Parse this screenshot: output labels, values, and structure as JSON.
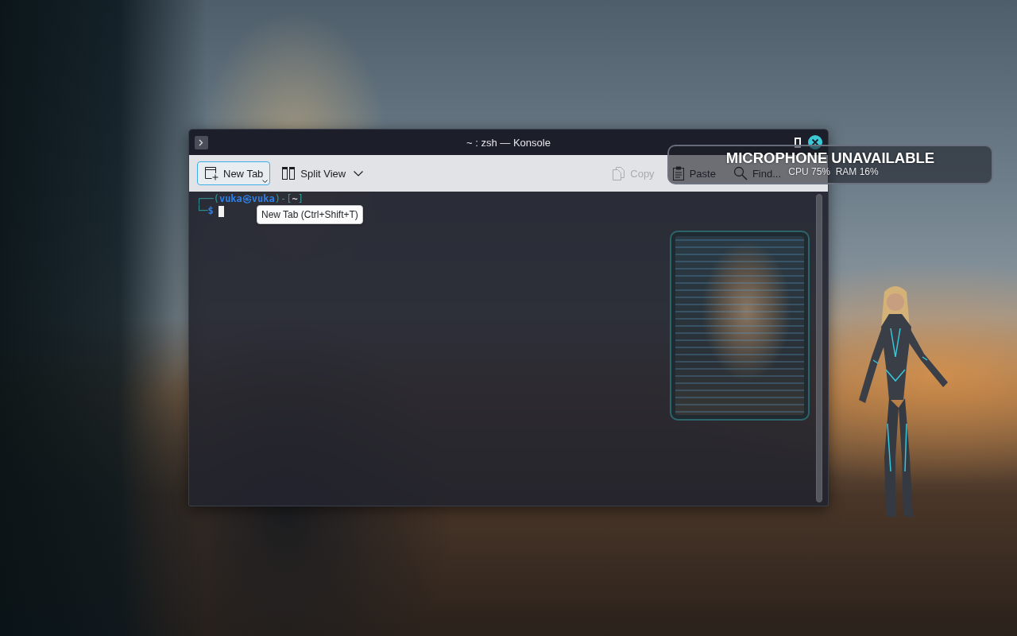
{
  "window": {
    "title": "~ : zsh — Konsole",
    "toolbar": {
      "left": [
        {
          "kind": "new-tab",
          "label": "New Tab",
          "hovered": true,
          "disabled": false,
          "menu_indicator": true,
          "dropdown": false
        },
        {
          "kind": "split-view",
          "label": "Split View",
          "hovered": false,
          "disabled": false,
          "menu_indicator": false,
          "dropdown": true
        }
      ],
      "right": [
        {
          "kind": "copy",
          "label": "Copy",
          "hovered": false,
          "disabled": true,
          "menu_indicator": false,
          "dropdown": false
        },
        {
          "kind": "paste",
          "label": "Paste",
          "hovered": false,
          "disabled": false,
          "menu_indicator": false,
          "dropdown": false
        },
        {
          "kind": "find",
          "label": "Find...",
          "hovered": false,
          "disabled": false,
          "menu_indicator": false,
          "dropdown": false
        }
      ]
    },
    "terminal": {
      "lines": [
        {
          "segments": [
            {
              "kind": "frame",
              "text": "┌──("
            },
            {
              "kind": "user",
              "text": "vuka㉿vuka"
            },
            {
              "kind": "frame",
              "text": ")-["
            },
            {
              "kind": "path",
              "text": "~"
            },
            {
              "kind": "frame",
              "text": "]"
            }
          ],
          "cursor": false
        },
        {
          "segments": [
            {
              "kind": "frame",
              "text": "└─"
            },
            {
              "kind": "prompt",
              "text": "$"
            }
          ],
          "cursor": true
        }
      ]
    },
    "tooltip": "New Tab (Ctrl+Shift+T)"
  },
  "notification": {
    "title": "MICROPHONE UNAVAILABLE",
    "detail": "CPU 75%  RAM 16%"
  }
}
